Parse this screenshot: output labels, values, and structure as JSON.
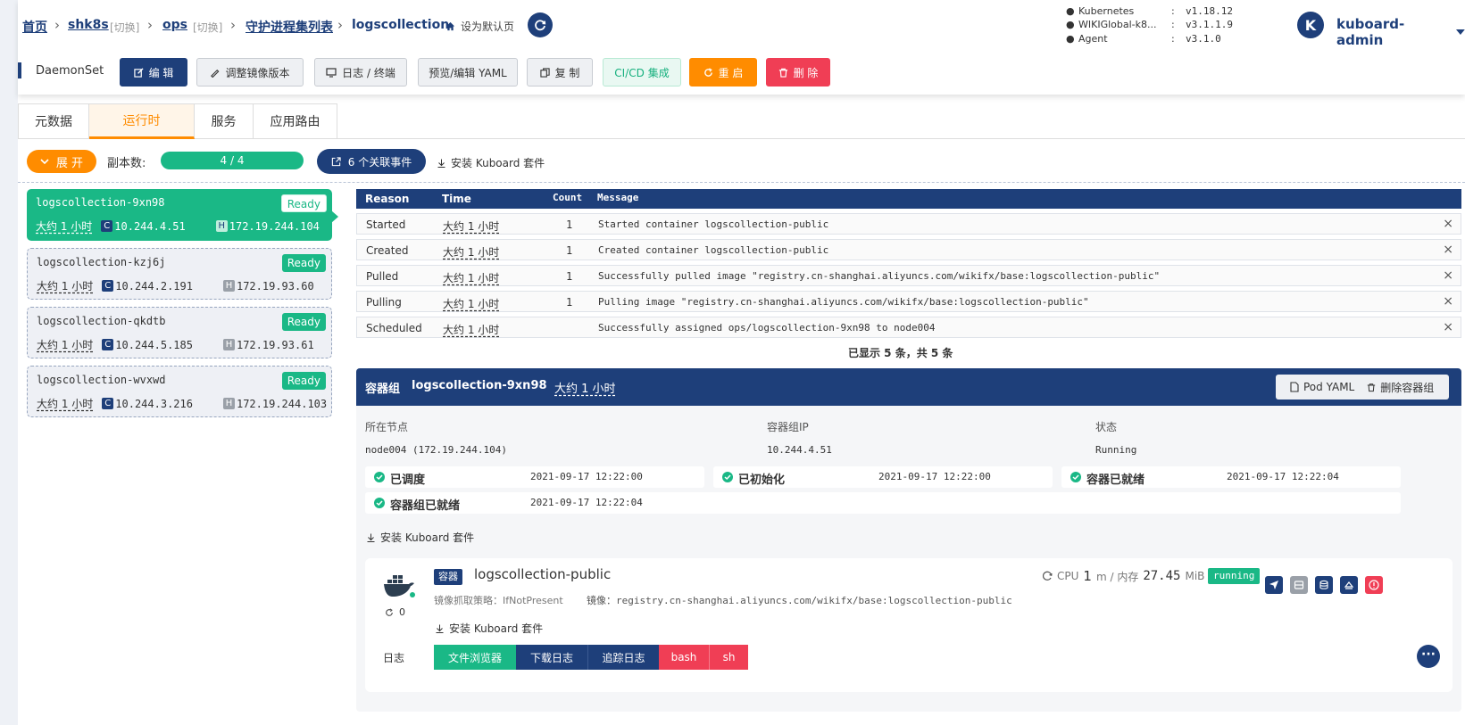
{
  "breadcrumb": {
    "home": "首页",
    "cluster": "shk8s",
    "switch1": "[切换]",
    "ns": "ops",
    "switch2": "[切换]",
    "list": "守护进程集列表",
    "current": "logscollection",
    "set_default": "设为默认页"
  },
  "versions": [
    {
      "name": "Kubernetes",
      "sep": ":",
      "value": "v1.18.12"
    },
    {
      "name": "WIKIGlobal-k8...",
      "sep": ":",
      "value": "v3.1.1.9"
    },
    {
      "name": "Agent",
      "sep": ":",
      "value": "v3.1.0"
    }
  ],
  "user": {
    "avatar_letter": "K",
    "name": "kuboard-admin"
  },
  "toolbar": {
    "kind": "DaemonSet",
    "edit": "编 辑",
    "adjust_image": "调整镜像版本",
    "logs": "日志 / 终端",
    "preview_yaml": "预览/编辑 YAML",
    "copy": "复 制",
    "cicd": "CI/CD 集成",
    "restart": "重 启",
    "delete": "删 除"
  },
  "tabs": [
    {
      "label": "元数据"
    },
    {
      "label": "运行时"
    },
    {
      "label": "服务"
    },
    {
      "label": "应用路由"
    }
  ],
  "controls": {
    "expand": "展 开",
    "replicas_label": "副本数:",
    "replicas": "4 / 4",
    "events_btn": "6 个关联事件",
    "install_suite": "安装 Kuboard 套件"
  },
  "pods": [
    {
      "name": "logscollection-9xn98",
      "status": "Ready",
      "age": "大约 1 小时",
      "c": "C",
      "cip": "10.244.4.51",
      "h": "H",
      "hip": "172.19.244.104"
    },
    {
      "name": "logscollection-kzj6j",
      "status": "Ready",
      "age": "大约 1 小时",
      "c": "C",
      "cip": "10.244.2.191",
      "h": "H",
      "hip": "172.19.93.60"
    },
    {
      "name": "logscollection-qkdtb",
      "status": "Ready",
      "age": "大约 1 小时",
      "c": "C",
      "cip": "10.244.5.185",
      "h": "H",
      "hip": "172.19.93.61"
    },
    {
      "name": "logscollection-wvxwd",
      "status": "Ready",
      "age": "大约 1 小时",
      "c": "C",
      "cip": "10.244.3.216",
      "h": "H",
      "hip": "172.19.244.103"
    }
  ],
  "events": {
    "headers": {
      "reason": "Reason",
      "time": "Time",
      "count": "Count",
      "message": "Message"
    },
    "rows": [
      {
        "reason": "Started",
        "time": "大约 1 小时",
        "count": "1",
        "message": "Started container logscollection-public"
      },
      {
        "reason": "Created",
        "time": "大约 1 小时",
        "count": "1",
        "message": "Created container logscollection-public"
      },
      {
        "reason": "Pulled",
        "time": "大约 1 小时",
        "count": "1",
        "message": "Successfully pulled image \"registry.cn-shanghai.aliyuncs.com/wikifx/base:logscollection-public\""
      },
      {
        "reason": "Pulling",
        "time": "大约 1 小时",
        "count": "1",
        "message": "Pulling image \"registry.cn-shanghai.aliyuncs.com/wikifx/base:logscollection-public\""
      },
      {
        "reason": "Scheduled",
        "time": "大约 1 小时",
        "count": "",
        "message": "Successfully assigned ops/logscollection-9xn98 to node004"
      }
    ],
    "summary": "已显示 5 条，共 5 条"
  },
  "pod_detail": {
    "title_label": "容器组",
    "name": "logscollection-9xn98",
    "age": "大约 1 小时",
    "pod_yaml": "Pod YAML",
    "delete_pod": "删除容器组",
    "node_label": "所在节点",
    "node_value": "node004 (172.19.244.104)",
    "ip_label": "容器组IP",
    "ip_value": "10.244.4.51",
    "status_label": "状态",
    "status_value": "Running",
    "conditions": [
      {
        "label": "已调度",
        "time": "2021-09-17 12:22:00"
      },
      {
        "label": "已初始化",
        "time": "2021-09-17 12:22:00"
      },
      {
        "label": "容器已就绪",
        "time": "2021-09-17 12:22:04"
      },
      {
        "label": "容器组已就绪",
        "time": "2021-09-17 12:22:04"
      }
    ],
    "install_suite": "安装 Kuboard 套件"
  },
  "container": {
    "badge": "容器",
    "name": "logscollection-public",
    "restarts": "0",
    "cpu_label": "CPU",
    "cpu_value": "1",
    "cpu_unit": "m / 内存",
    "mem_value": "27.45",
    "mem_unit": "MiB",
    "state": "running",
    "pull_policy": "镜像抓取策略：IfNotPresent",
    "image": "镜像：registry.cn-shanghai.aliyuncs.com/wikifx/base:logscollection-public",
    "install_suite": "安装 Kuboard 套件",
    "log_label": "日志",
    "actions": [
      "文件浏览器",
      "下载日志",
      "追踪日志",
      "bash",
      "sh"
    ]
  },
  "colors": {
    "primary": "#1e3f7a",
    "green": "#1ab886",
    "orange": "#ff8c00",
    "red": "#f03e55"
  }
}
